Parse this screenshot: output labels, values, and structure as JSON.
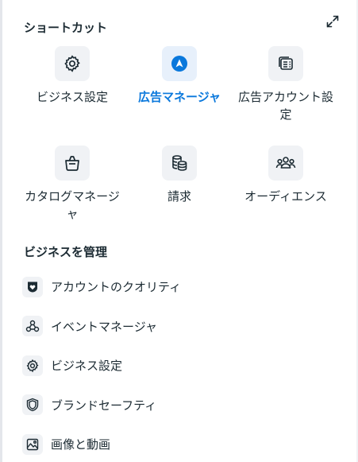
{
  "shortcuts": {
    "title": "ショートカット",
    "items": [
      {
        "label": "ビジネス設定",
        "icon": "gear-icon",
        "active": false
      },
      {
        "label": "広告マネージャ",
        "icon": "ads-manager-icon",
        "active": true
      },
      {
        "label": "広告アカウント設定",
        "icon": "ad-account-settings-icon",
        "active": false
      },
      {
        "label": "カタログマネージャ",
        "icon": "shopping-bag-icon",
        "active": false
      },
      {
        "label": "請求",
        "icon": "coins-stack-icon",
        "active": false
      },
      {
        "label": "オーディエンス",
        "icon": "people-group-icon",
        "active": false
      }
    ]
  },
  "manage": {
    "title": "ビジネスを管理",
    "items": [
      {
        "label": "アカウントのクオリティ",
        "icon": "shield-heart-icon"
      },
      {
        "label": "イベントマネージャ",
        "icon": "event-nodes-icon"
      },
      {
        "label": "ビジネス設定",
        "icon": "gear-icon"
      },
      {
        "label": "ブランドセーフティ",
        "icon": "shield-icon"
      },
      {
        "label": "画像と動画",
        "icon": "image-icon"
      }
    ]
  },
  "colors": {
    "accent": "#0a78dc",
    "icon_bg": "#f0f2f5",
    "text": "#1c2b33"
  }
}
